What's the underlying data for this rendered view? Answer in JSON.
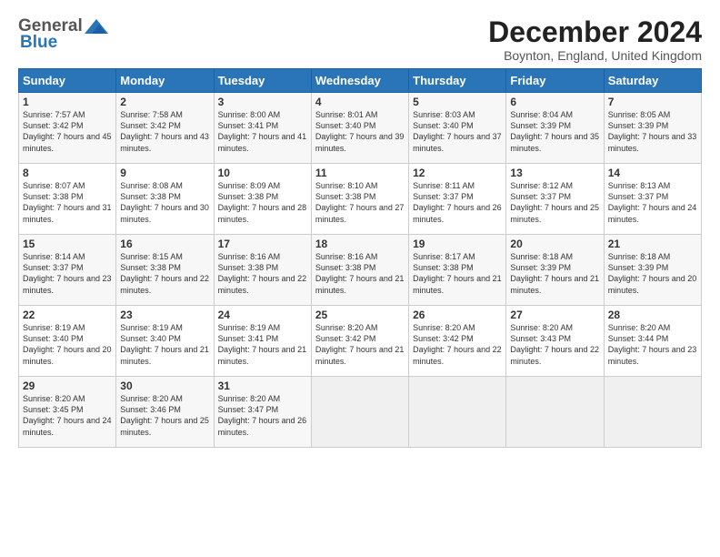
{
  "logo": {
    "general": "General",
    "blue": "Blue"
  },
  "title": "December 2024",
  "location": "Boynton, England, United Kingdom",
  "days_of_week": [
    "Sunday",
    "Monday",
    "Tuesday",
    "Wednesday",
    "Thursday",
    "Friday",
    "Saturday"
  ],
  "weeks": [
    [
      {
        "day": "1",
        "sunrise": "7:57 AM",
        "sunset": "3:42 PM",
        "daylight": "7 hours and 45 minutes."
      },
      {
        "day": "2",
        "sunrise": "7:58 AM",
        "sunset": "3:42 PM",
        "daylight": "7 hours and 43 minutes."
      },
      {
        "day": "3",
        "sunrise": "8:00 AM",
        "sunset": "3:41 PM",
        "daylight": "7 hours and 41 minutes."
      },
      {
        "day": "4",
        "sunrise": "8:01 AM",
        "sunset": "3:40 PM",
        "daylight": "7 hours and 39 minutes."
      },
      {
        "day": "5",
        "sunrise": "8:03 AM",
        "sunset": "3:40 PM",
        "daylight": "7 hours and 37 minutes."
      },
      {
        "day": "6",
        "sunrise": "8:04 AM",
        "sunset": "3:39 PM",
        "daylight": "7 hours and 35 minutes."
      },
      {
        "day": "7",
        "sunrise": "8:05 AM",
        "sunset": "3:39 PM",
        "daylight": "7 hours and 33 minutes."
      }
    ],
    [
      {
        "day": "8",
        "sunrise": "8:07 AM",
        "sunset": "3:38 PM",
        "daylight": "7 hours and 31 minutes."
      },
      {
        "day": "9",
        "sunrise": "8:08 AM",
        "sunset": "3:38 PM",
        "daylight": "7 hours and 30 minutes."
      },
      {
        "day": "10",
        "sunrise": "8:09 AM",
        "sunset": "3:38 PM",
        "daylight": "7 hours and 28 minutes."
      },
      {
        "day": "11",
        "sunrise": "8:10 AM",
        "sunset": "3:38 PM",
        "daylight": "7 hours and 27 minutes."
      },
      {
        "day": "12",
        "sunrise": "8:11 AM",
        "sunset": "3:37 PM",
        "daylight": "7 hours and 26 minutes."
      },
      {
        "day": "13",
        "sunrise": "8:12 AM",
        "sunset": "3:37 PM",
        "daylight": "7 hours and 25 minutes."
      },
      {
        "day": "14",
        "sunrise": "8:13 AM",
        "sunset": "3:37 PM",
        "daylight": "7 hours and 24 minutes."
      }
    ],
    [
      {
        "day": "15",
        "sunrise": "8:14 AM",
        "sunset": "3:37 PM",
        "daylight": "7 hours and 23 minutes."
      },
      {
        "day": "16",
        "sunrise": "8:15 AM",
        "sunset": "3:38 PM",
        "daylight": "7 hours and 22 minutes."
      },
      {
        "day": "17",
        "sunrise": "8:16 AM",
        "sunset": "3:38 PM",
        "daylight": "7 hours and 22 minutes."
      },
      {
        "day": "18",
        "sunrise": "8:16 AM",
        "sunset": "3:38 PM",
        "daylight": "7 hours and 21 minutes."
      },
      {
        "day": "19",
        "sunrise": "8:17 AM",
        "sunset": "3:38 PM",
        "daylight": "7 hours and 21 minutes."
      },
      {
        "day": "20",
        "sunrise": "8:18 AM",
        "sunset": "3:39 PM",
        "daylight": "7 hours and 21 minutes."
      },
      {
        "day": "21",
        "sunrise": "8:18 AM",
        "sunset": "3:39 PM",
        "daylight": "7 hours and 20 minutes."
      }
    ],
    [
      {
        "day": "22",
        "sunrise": "8:19 AM",
        "sunset": "3:40 PM",
        "daylight": "7 hours and 20 minutes."
      },
      {
        "day": "23",
        "sunrise": "8:19 AM",
        "sunset": "3:40 PM",
        "daylight": "7 hours and 21 minutes."
      },
      {
        "day": "24",
        "sunrise": "8:19 AM",
        "sunset": "3:41 PM",
        "daylight": "7 hours and 21 minutes."
      },
      {
        "day": "25",
        "sunrise": "8:20 AM",
        "sunset": "3:42 PM",
        "daylight": "7 hours and 21 minutes."
      },
      {
        "day": "26",
        "sunrise": "8:20 AM",
        "sunset": "3:42 PM",
        "daylight": "7 hours and 22 minutes."
      },
      {
        "day": "27",
        "sunrise": "8:20 AM",
        "sunset": "3:43 PM",
        "daylight": "7 hours and 22 minutes."
      },
      {
        "day": "28",
        "sunrise": "8:20 AM",
        "sunset": "3:44 PM",
        "daylight": "7 hours and 23 minutes."
      }
    ],
    [
      {
        "day": "29",
        "sunrise": "8:20 AM",
        "sunset": "3:45 PM",
        "daylight": "7 hours and 24 minutes."
      },
      {
        "day": "30",
        "sunrise": "8:20 AM",
        "sunset": "3:46 PM",
        "daylight": "7 hours and 25 minutes."
      },
      {
        "day": "31",
        "sunrise": "8:20 AM",
        "sunset": "3:47 PM",
        "daylight": "7 hours and 26 minutes."
      },
      null,
      null,
      null,
      null
    ]
  ]
}
